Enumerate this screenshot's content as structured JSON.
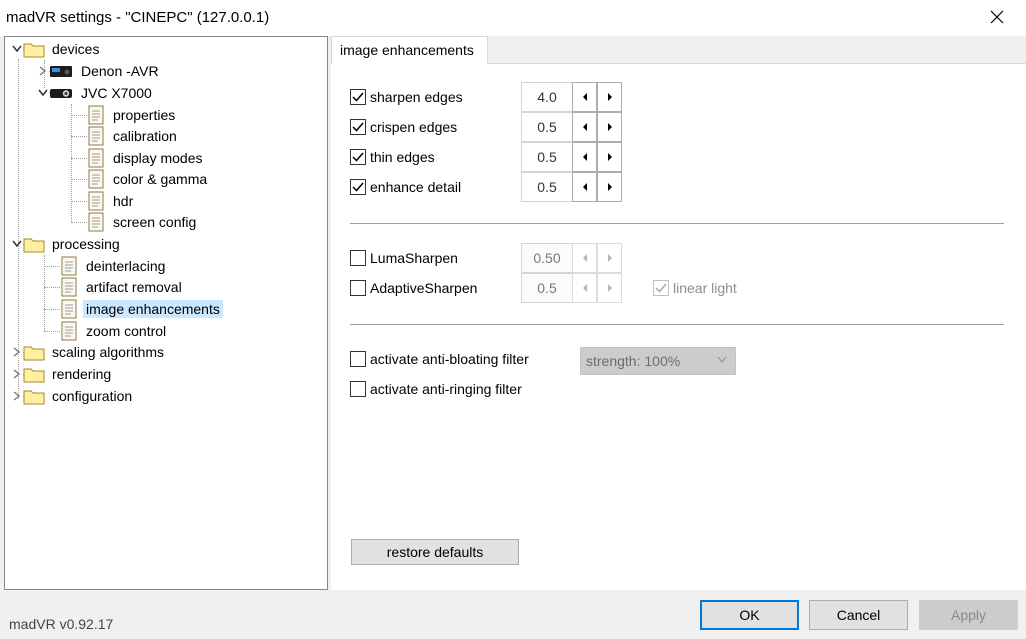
{
  "window": {
    "title": "madVR settings - \"CINEPC\" (127.0.0.1)"
  },
  "tree": {
    "devices": "devices",
    "denon": "Denon -AVR",
    "jvc": "JVC X7000",
    "jvc_children": [
      "properties",
      "calibration",
      "display modes",
      "color & gamma",
      "hdr",
      "screen config"
    ],
    "processing": "processing",
    "processing_children": [
      "deinterlacing",
      "artifact removal",
      "image enhancements",
      "zoom control"
    ],
    "scaling": "scaling algorithms",
    "rendering": "rendering",
    "configuration": "configuration",
    "selected": "image enhancements"
  },
  "tab": {
    "label": "image enhancements"
  },
  "options": [
    {
      "label": "sharpen edges",
      "checked": true,
      "value": "4.0",
      "enabled": true
    },
    {
      "label": "crispen edges",
      "checked": true,
      "value": "0.5",
      "enabled": true
    },
    {
      "label": "thin edges",
      "checked": true,
      "value": "0.5",
      "enabled": true
    },
    {
      "label": "enhance detail",
      "checked": true,
      "value": "0.5",
      "enabled": true
    }
  ],
  "sharpeners": [
    {
      "label": "LumaSharpen",
      "checked": false,
      "value": "0.50",
      "enabled": false
    },
    {
      "label": "AdaptiveSharpen",
      "checked": false,
      "value": "0.5",
      "enabled": false
    }
  ],
  "linear_light": {
    "label": "linear light",
    "checked": true,
    "enabled": false
  },
  "filters": {
    "anti_bloating": {
      "label": "activate anti-bloating filter",
      "checked": false
    },
    "anti_ringing": {
      "label": "activate anti-ringing filter",
      "checked": false
    },
    "strength": "strength: 100%"
  },
  "buttons": {
    "restore": "restore defaults",
    "ok": "OK",
    "cancel": "Cancel",
    "apply": "Apply"
  },
  "footer": {
    "version": "madVR v0.92.17"
  },
  "icons": {
    "close": "close-icon",
    "folder": "folder-icon",
    "page": "page-icon",
    "device": "device-icon"
  }
}
